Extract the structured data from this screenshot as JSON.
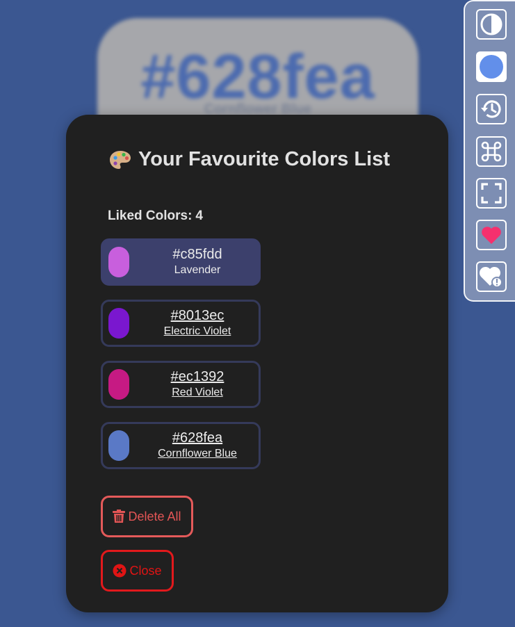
{
  "background": {
    "hex": "#628fea",
    "name": "Cornflower Blue"
  },
  "toolbar": {
    "buttons": [
      {
        "name": "contrast-toggle",
        "icon": "contrast-icon"
      },
      {
        "name": "current-color",
        "icon": "color-circle-icon",
        "color": "#628fea"
      },
      {
        "name": "history",
        "icon": "history-icon"
      },
      {
        "name": "shortcuts",
        "icon": "command-key-icon"
      },
      {
        "name": "fullscreen",
        "icon": "fullscreen-icon"
      },
      {
        "name": "like",
        "icon": "heart-icon",
        "color": "#f5306e"
      },
      {
        "name": "favourites",
        "icon": "heart-info-icon"
      }
    ]
  },
  "modal": {
    "title": "Your Favourite Colors List",
    "liked_label": "Liked Colors:",
    "liked_count": "4",
    "colors": [
      {
        "hex": "#c85fdd",
        "name": "Lavender",
        "swatch": "#c85fdd",
        "active": true
      },
      {
        "hex": "#8013ec",
        "name": "Electric Violet",
        "swatch": "#7a17cf",
        "active": false
      },
      {
        "hex": "#ec1392",
        "name": "Red Violet",
        "swatch": "#c61a83",
        "active": false
      },
      {
        "hex": "#628fea",
        "name": "Cornflower Blue",
        "swatch": "#5a79c6",
        "active": false
      }
    ],
    "delete_label": "Delete All",
    "close_label": "Close"
  }
}
